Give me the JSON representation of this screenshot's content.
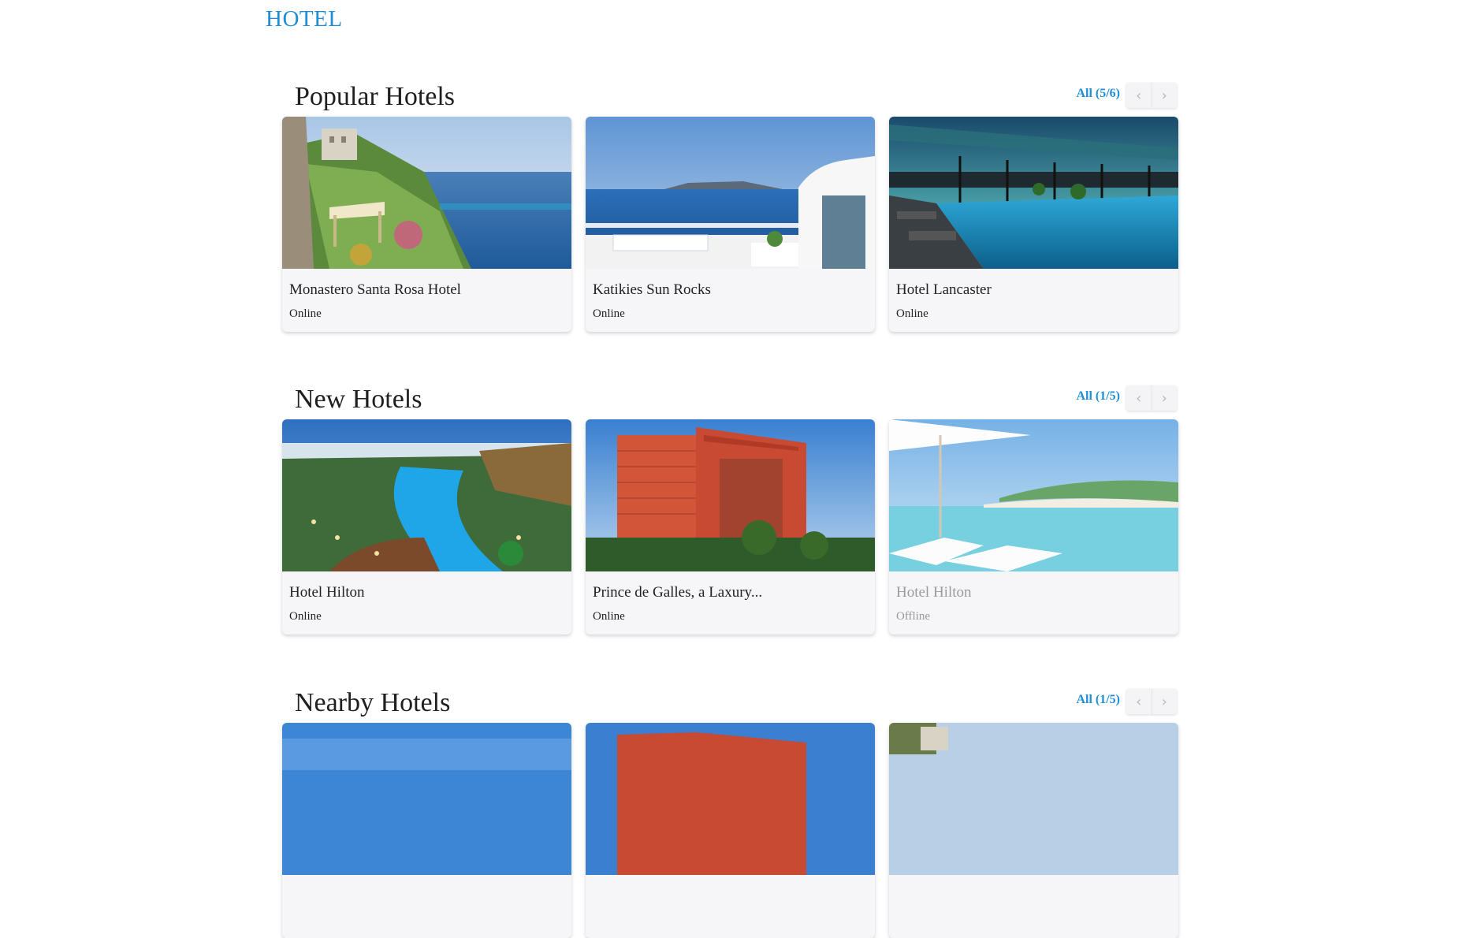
{
  "header": {
    "brand": "HOTEL"
  },
  "sections": [
    {
      "title": "Popular Hotels",
      "all_label": "All (5/6)",
      "cards": [
        {
          "name": "Monastero Santa Rosa Hotel",
          "status": "Online"
        },
        {
          "name": "Katikies Sun Rocks",
          "status": "Online"
        },
        {
          "name": "Hotel Lancaster",
          "status": "Online"
        }
      ]
    },
    {
      "title": "New Hotels",
      "all_label": "All (1/5)",
      "cards": [
        {
          "name": "Hotel Hilton",
          "status": "Online"
        },
        {
          "name": "Prince de Galles, a Laxury...",
          "status": "Online"
        },
        {
          "name": "Hotel Hilton",
          "status": "Offline"
        }
      ]
    },
    {
      "title": "Nearby Hotels",
      "all_label": "All (1/5)",
      "cards": []
    }
  ],
  "pager": {
    "prev_glyph": "‹",
    "next_glyph": "›"
  },
  "colors": {
    "accent": "#1e8fd6",
    "card_bg": "#f6f6f8",
    "offline_text": "#9a9a9a"
  }
}
